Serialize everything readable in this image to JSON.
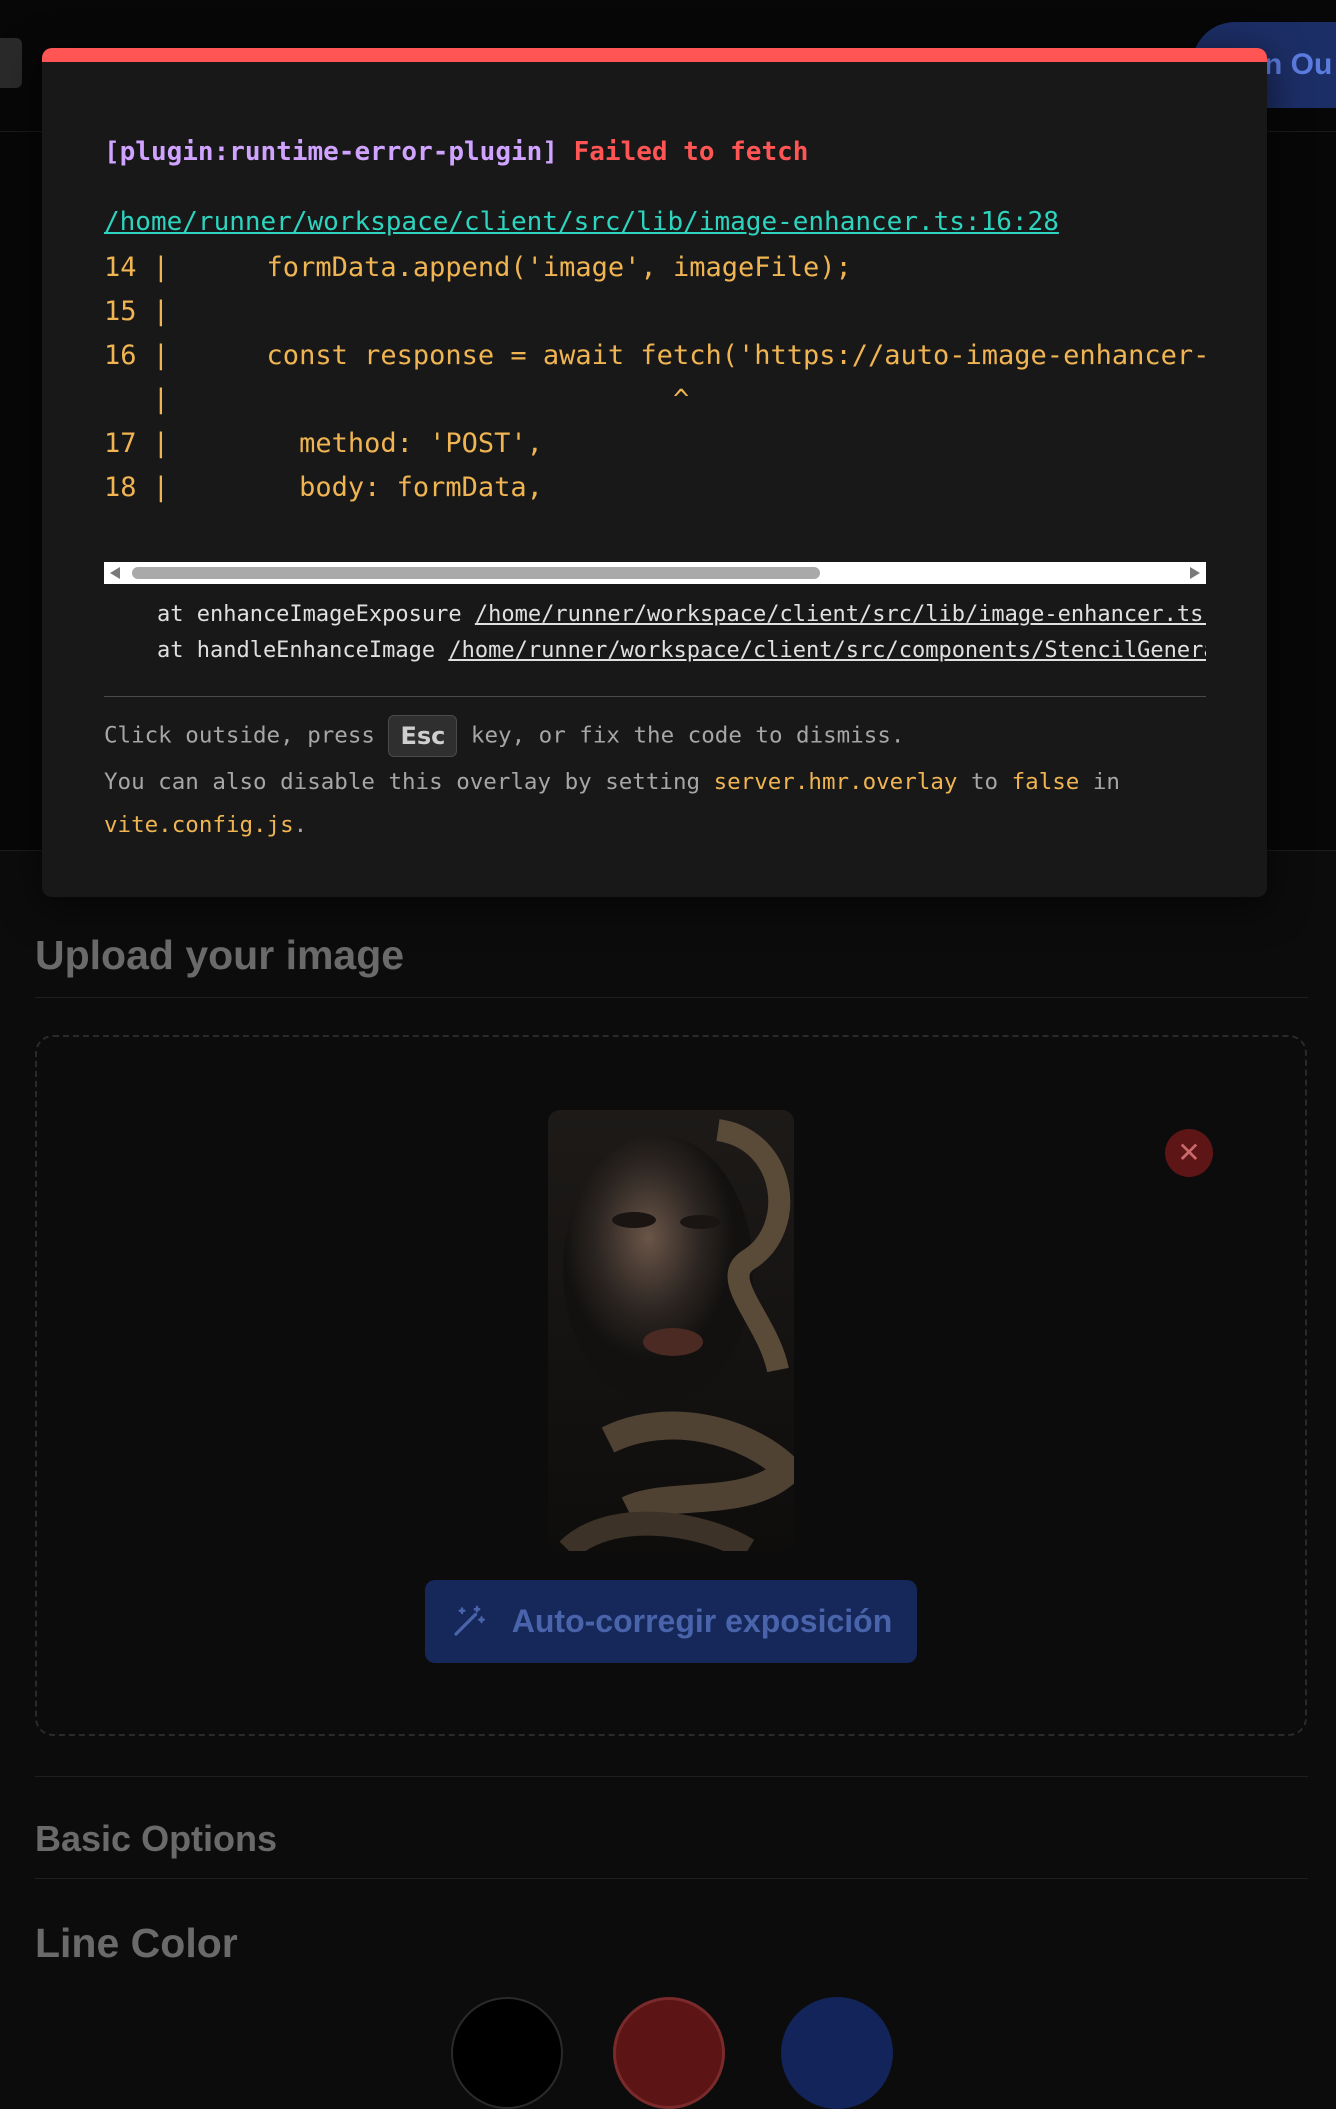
{
  "header": {
    "signout_label": "n Ou"
  },
  "upload": {
    "title": "Upload your image",
    "enhance_label": "Auto-corregir exposición"
  },
  "options": {
    "basic_title": "Basic Options",
    "line_color_title": "Line Color",
    "line_colors": [
      "#000000",
      "#5c1414",
      "#13245a"
    ]
  },
  "error_overlay": {
    "plugin": "[plugin:runtime-error-plugin]",
    "message": "Failed to fetch",
    "file": "/home/runner/workspace/client/src/lib/image-enhancer.ts:16:28",
    "code_lines": [
      "14 |      formData.append('image', imageFile);",
      "15 |",
      "16 |      const response = await fetch('https://auto-image-enhancer-c",
      "   |                               ^",
      "17 |        method: 'POST',",
      "18 |        body: formData,"
    ],
    "stack": [
      {
        "prefix": "    at enhanceImageExposure ",
        "link": "/home/runner/workspace/client/src/lib/image-enhancer.ts:"
      },
      {
        "prefix": "    at handleEnhanceImage ",
        "link": "/home/runner/workspace/client/src/components/StencilGenera"
      }
    ],
    "tip1_before": "Click outside, press ",
    "tip1_key": "Esc",
    "tip1_after": " key, or fix the code to dismiss.",
    "tip2_a": "You can also disable this overlay by setting ",
    "tip2_setting": "server.hmr.overlay",
    "tip2_b": " to ",
    "tip2_value": "false",
    "tip2_c": " in",
    "tip3_file": "vite.config.js",
    "tip3_end": "."
  },
  "colors": {
    "error_accent": "#ff5555",
    "plugin": "#cfa3ff",
    "link": "#2dd4bf",
    "code": "#f0b552"
  }
}
